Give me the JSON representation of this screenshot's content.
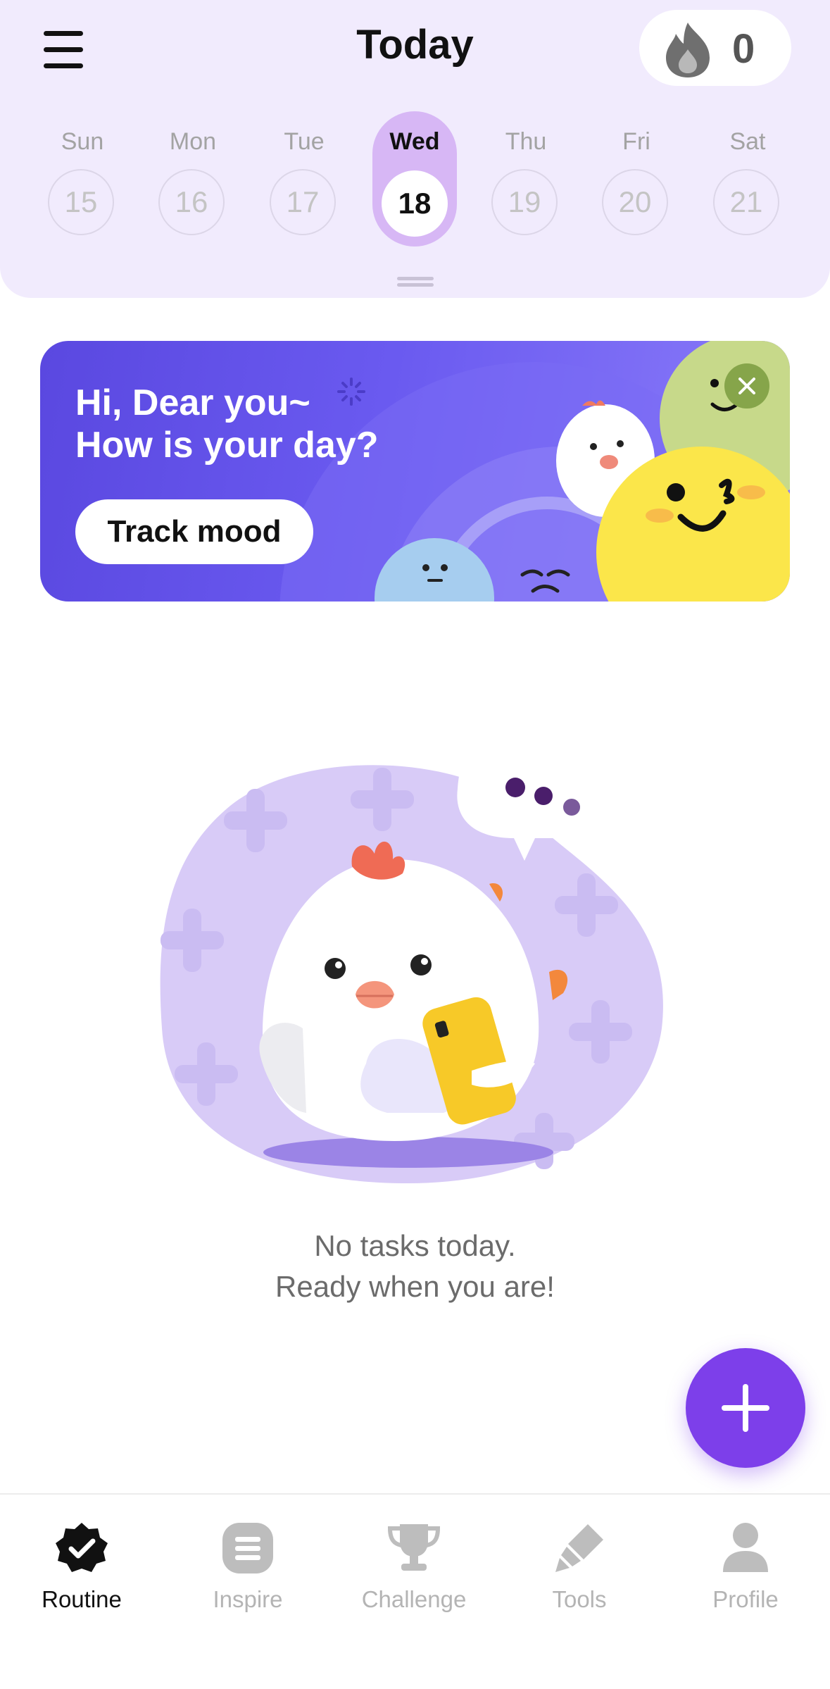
{
  "header": {
    "title": "Today",
    "streak_count": "0"
  },
  "week": [
    {
      "name": "Sun",
      "num": "15"
    },
    {
      "name": "Mon",
      "num": "16"
    },
    {
      "name": "Tue",
      "num": "17"
    },
    {
      "name": "Wed",
      "num": "18",
      "selected": true
    },
    {
      "name": "Thu",
      "num": "19"
    },
    {
      "name": "Fri",
      "num": "20"
    },
    {
      "name": "Sat",
      "num": "21"
    }
  ],
  "banner": {
    "line1": "Hi, Dear you~",
    "line2": "How is your day?",
    "button_label": "Track mood"
  },
  "empty_state": {
    "line1": "No tasks today.",
    "line2": "Ready when you are!"
  },
  "tabs": [
    {
      "label": "Routine",
      "icon": "check-badge-icon",
      "active": true
    },
    {
      "label": "Inspire",
      "icon": "list-icon"
    },
    {
      "label": "Challenge",
      "icon": "trophy-icon"
    },
    {
      "label": "Tools",
      "icon": "pen-tool-icon"
    },
    {
      "label": "Profile",
      "icon": "person-icon"
    }
  ],
  "colors": {
    "accent": "#7d3fea",
    "header_bg": "#f1ebfd",
    "selected_day": "#d7b7f5",
    "banner": "#6a5af0"
  }
}
